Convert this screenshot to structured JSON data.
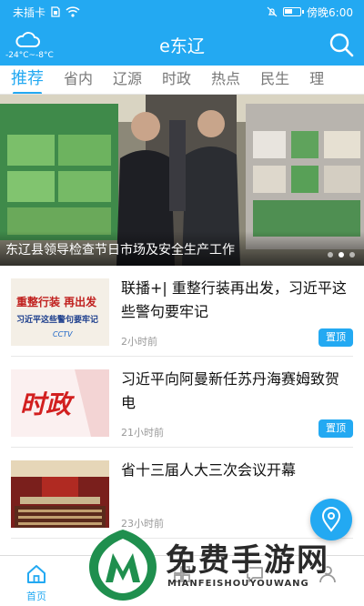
{
  "status_bar": {
    "carrier": "未插卡",
    "time": "傍晚6:00"
  },
  "header": {
    "title": "e东辽",
    "weather_text": "-24°C~-8°C",
    "weather_icon": "cloud-icon",
    "search_icon": "search-icon"
  },
  "tabs": [
    {
      "label": "推荐",
      "active": true
    },
    {
      "label": "省内"
    },
    {
      "label": "辽源"
    },
    {
      "label": "时政"
    },
    {
      "label": "热点"
    },
    {
      "label": "民生"
    },
    {
      "label": "理"
    }
  ],
  "banner": {
    "caption": "东辽县领导检查节日市场及安全生产工作",
    "slide_count": 3,
    "active_slide": 2
  },
  "news": [
    {
      "title": "联播+| 重整行装再出发，习近平这些警句要牢记",
      "time": "2小时前",
      "badge": "置顶",
      "thumb_text_line1": "重整行装 再出发",
      "thumb_text_line2": "习近平这些警句要牢记",
      "thumb_logo": "CCTV"
    },
    {
      "title": "习近平向阿曼新任苏丹海赛姆致贺电",
      "time": "21小时前",
      "badge": "置顶",
      "thumb_text": "时政"
    },
    {
      "title": "省十三届人大三次会议开幕",
      "time": "23小时前"
    }
  ],
  "bottom_nav": [
    {
      "label": "首页",
      "active": true,
      "icon": "home-icon"
    },
    {
      "label": "",
      "icon": "video-icon"
    },
    {
      "label": "",
      "icon": "service-icon"
    },
    {
      "label": "",
      "icon": "community-icon"
    },
    {
      "label": "",
      "icon": "user-icon"
    }
  ],
  "watermark": {
    "title": "免费手游网",
    "subtitle": "MIANFEISHOUYOUWANG"
  },
  "colors": {
    "brand": "#23a9f2",
    "badge": "#23a9f2",
    "watermark_green": "#1f8f4e"
  }
}
